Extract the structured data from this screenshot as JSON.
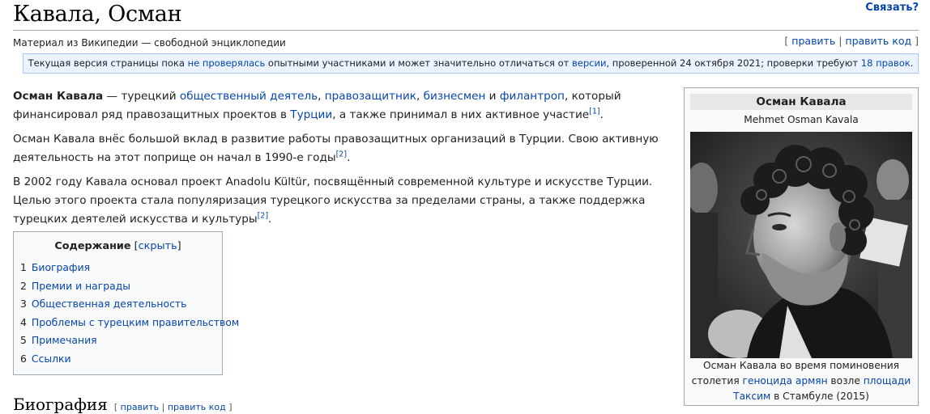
{
  "header": {
    "title": "Кавала, Осман",
    "contact_link": "Связать?",
    "tagline": "Материал из Википедии — свободной энциклопедии",
    "edit_links": {
      "open": "[",
      "edit": "править",
      "sep": "|",
      "edit_code": "править код",
      "close": "]"
    }
  },
  "flagged_notice": {
    "t1": "Текущая версия страницы пока ",
    "l1": "не проверялась",
    "t2": " опытными участниками и может значительно отличаться от ",
    "l2": "версии",
    "t3": ", проверенной 24 октября 2021; проверки требуют ",
    "l3": "18 правок",
    "t4": "."
  },
  "article": {
    "p1": {
      "bold": "Осман Кавала",
      "t1": " — турецкий ",
      "l1": "общественный деятель",
      "t2": ", ",
      "l2": "правозащитник",
      "t3": ", ",
      "l3": "бизнесмен",
      "t4": " и ",
      "l4": "филантроп",
      "t5": ", который финансировал ряд правозащитных проектов в ",
      "l5": "Турции",
      "t6": ", а также принимал в них активное участие",
      "ref": "[1]",
      "t7": "."
    },
    "p2": {
      "t1": "Осман Кавала внёс большой вклад в развитие работы правозащитных организаций в Турции. Свою активную деятельность на этот поприще он начал в 1990-е годы",
      "ref": "[2]",
      "t2": "."
    },
    "p3": {
      "t1": "В 2002 году Кавала основал проект Anadolu Kültür, посвящённый современной культуре и искусстве Турции. Целью этого проекта стала популяризация турецкого искусства за пределами страны, а также поддержка турецких деятелей искусства и культуры",
      "ref": "[2]",
      "t2": "."
    }
  },
  "toc": {
    "title": "Содержание",
    "hide_open": " [",
    "hide": "скрыть",
    "hide_close": "]",
    "items": [
      {
        "num": "1",
        "label": "Биография"
      },
      {
        "num": "2",
        "label": "Премии и награды"
      },
      {
        "num": "3",
        "label": "Общественная деятельность"
      },
      {
        "num": "4",
        "label": "Проблемы с турецким правительством"
      },
      {
        "num": "5",
        "label": "Примечания"
      },
      {
        "num": "6",
        "label": "Ссылки"
      }
    ]
  },
  "section": {
    "heading": "Биография",
    "edit_open": "[",
    "edit": "править",
    "sep": "|",
    "edit_code": "править код",
    "edit_close": "]"
  },
  "infobox": {
    "name": "Осман Кавала",
    "native_name": "Mehmet Osman Kavala",
    "caption": {
      "t1": "Осман Кавала во время поминовения столетия ",
      "l1": "геноцида армян",
      "t2": " возле ",
      "l2": "площади Таксим",
      "t3": " в Стамбуле (2015)"
    }
  },
  "colors": {
    "link": "#0645ad",
    "text": "#202122",
    "notice_bg": "#eaf3ff",
    "notice_border": "#a7c9ee",
    "box_bg": "#f8f9fa",
    "box_border": "#a2a9b1"
  }
}
